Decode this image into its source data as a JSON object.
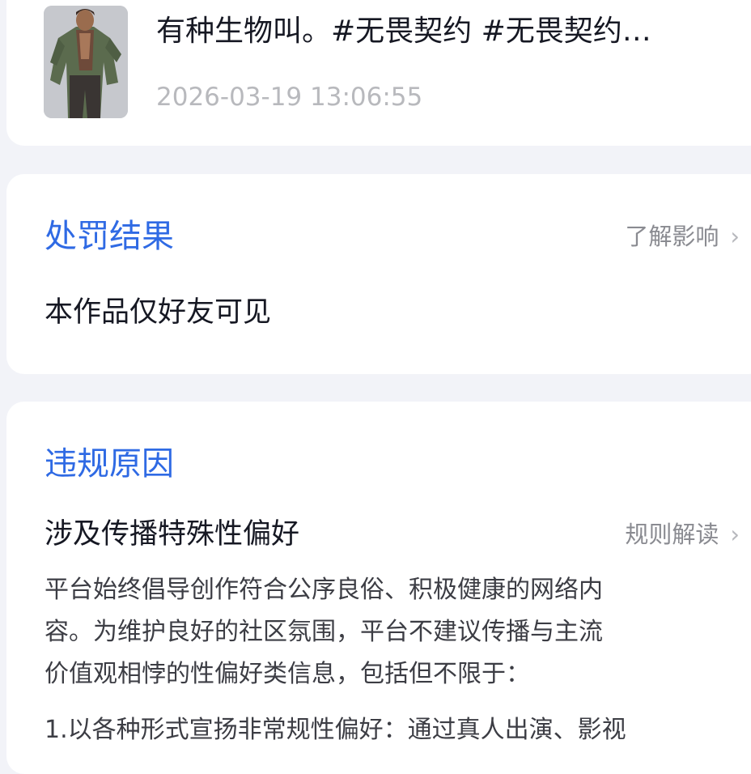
{
  "video": {
    "title": "有种生物叫。#无畏契约 #无畏契约…",
    "time": "2026-03-19 13:06:55",
    "thumbnail_icon": "video-thumbnail"
  },
  "penalty": {
    "title": "处罚结果",
    "link": "了解影响",
    "result": "本作品仅好友可见"
  },
  "violation": {
    "title": "违规原因",
    "reason": "涉及传播特殊性偏好",
    "link": "规则解读",
    "lines": [
      "平台始终倡导创作符合公序良俗、积极健康的网络内",
      "容。为维护良好的社区氛围，平台不建议传播与主流",
      "价值观相悖的性偏好类信息，包括但不限于："
    ],
    "item1": "1.以各种形式宣扬非常规性偏好：通过真人出演、影视"
  },
  "colors": {
    "accent": "#2f6ae4",
    "background": "#f2f3f8",
    "muted": "#8a8b91"
  }
}
